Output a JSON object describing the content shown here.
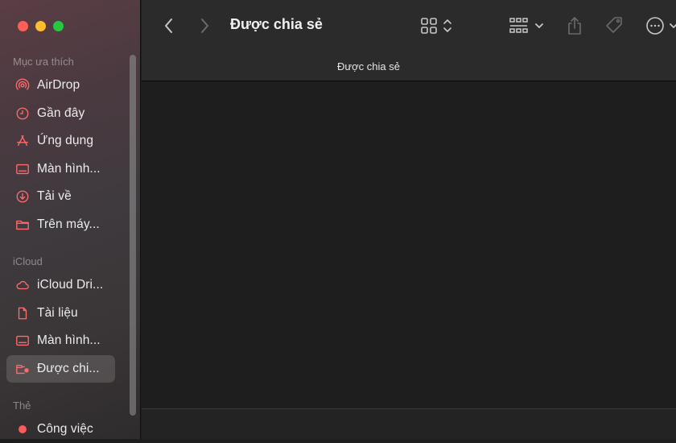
{
  "window": {
    "title": "Được chia sẻ",
    "path_title": "Được chia sẻ"
  },
  "sidebar": {
    "favorites_title": "Mục ưa thích",
    "favorites": [
      {
        "label": "AirDrop",
        "icon": "airdrop-icon"
      },
      {
        "label": "Gần đây",
        "icon": "clock-icon"
      },
      {
        "label": "Ứng dụng",
        "icon": "apps-icon"
      },
      {
        "label": "Màn hình...",
        "icon": "desktop-icon"
      },
      {
        "label": "Tải về",
        "icon": "download-icon"
      },
      {
        "label": "Trên máy...",
        "icon": "folder-icon"
      }
    ],
    "icloud_title": "iCloud",
    "icloud": [
      {
        "label": "iCloud Dri...",
        "icon": "cloud-icon"
      },
      {
        "label": "Tài liệu",
        "icon": "document-icon"
      },
      {
        "label": "Màn hình...",
        "icon": "desktop-icon"
      },
      {
        "label": "Được chi...",
        "icon": "shared-folder-icon",
        "selected": true
      }
    ],
    "tags_title": "Thẻ",
    "tags": [
      {
        "label": "Công việc",
        "color": "#ff5a5a"
      }
    ]
  },
  "colors": {
    "accent_icon": "#ff6b6b",
    "sidebar_text": "#ececec"
  }
}
